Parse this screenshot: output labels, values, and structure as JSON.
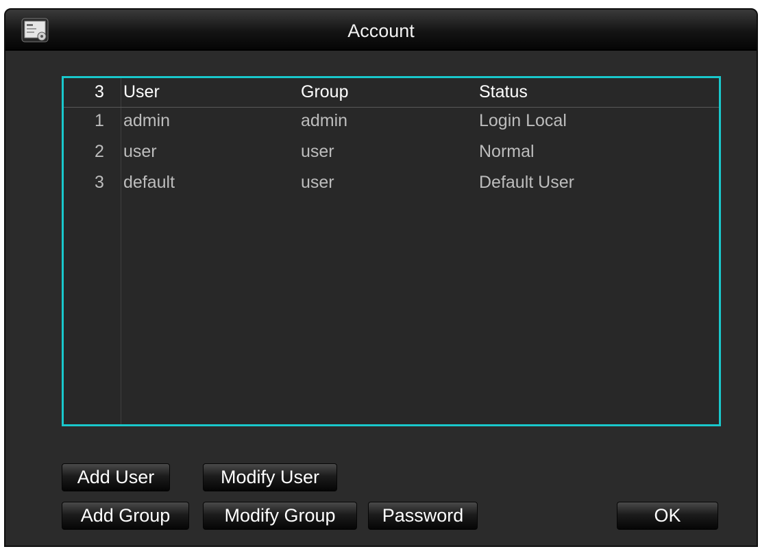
{
  "window": {
    "title": "Account",
    "icon": "account-manager-icon"
  },
  "list": {
    "headers": {
      "count": "3",
      "user": "User",
      "group": "Group",
      "status": "Status"
    },
    "rows": [
      {
        "num": "1",
        "user": "admin",
        "group": "admin",
        "status": "Login Local"
      },
      {
        "num": "2",
        "user": "user",
        "group": "user",
        "status": "Normal"
      },
      {
        "num": "3",
        "user": "default",
        "group": "user",
        "status": "Default User"
      }
    ],
    "border_color": "#19c8cc"
  },
  "buttons": {
    "add_user": "Add User",
    "modify_user": "Modify User",
    "add_group": "Add Group",
    "modify_group": "Modify Group",
    "password": "Password",
    "ok": "OK"
  }
}
